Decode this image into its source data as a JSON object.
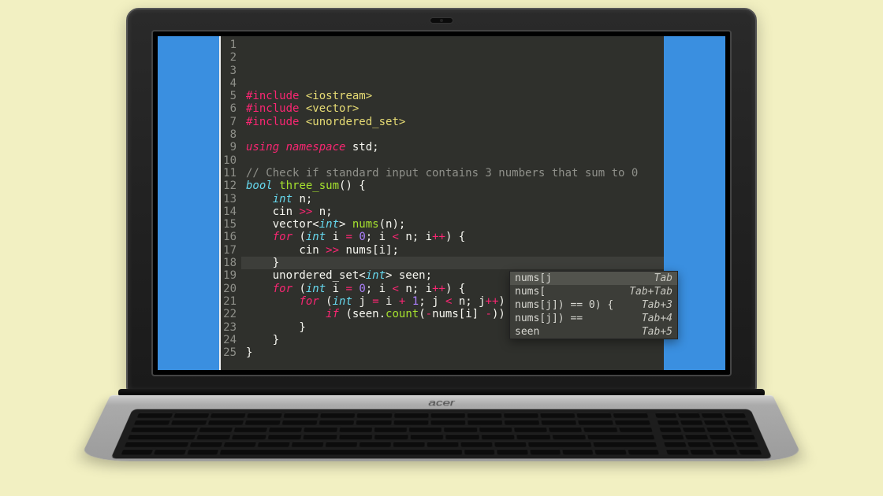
{
  "brand": "acer",
  "editor": {
    "total_lines": 25,
    "highlighted_line": 18,
    "lines": [
      {
        "n": 1,
        "tokens": [
          [
            "kw2",
            "#include"
          ],
          [
            "wh",
            " "
          ],
          [
            "st",
            "<iostream>"
          ]
        ]
      },
      {
        "n": 2,
        "tokens": [
          [
            "kw2",
            "#include"
          ],
          [
            "wh",
            " "
          ],
          [
            "st",
            "<vector>"
          ]
        ]
      },
      {
        "n": 3,
        "tokens": [
          [
            "kw2",
            "#include"
          ],
          [
            "wh",
            " "
          ],
          [
            "st",
            "<unordered_set>"
          ]
        ]
      },
      {
        "n": 4,
        "tokens": []
      },
      {
        "n": 5,
        "tokens": [
          [
            "kw",
            "using"
          ],
          [
            "wh",
            " "
          ],
          [
            "kw",
            "namespace"
          ],
          [
            "wh",
            " std;"
          ]
        ]
      },
      {
        "n": 6,
        "tokens": []
      },
      {
        "n": 7,
        "tokens": [
          [
            "co",
            "// Check if standard input contains 3 numbers that sum to 0"
          ]
        ]
      },
      {
        "n": 8,
        "tokens": [
          [
            "ty",
            "bool"
          ],
          [
            "wh",
            " "
          ],
          [
            "fn",
            "three_sum"
          ],
          [
            "wh",
            "() {"
          ]
        ]
      },
      {
        "n": 9,
        "tokens": [
          [
            "wh",
            "    "
          ],
          [
            "ty",
            "int"
          ],
          [
            "wh",
            " n;"
          ]
        ]
      },
      {
        "n": 10,
        "tokens": [
          [
            "wh",
            "    cin "
          ],
          [
            "op",
            ">>"
          ],
          [
            "wh",
            " n;"
          ]
        ]
      },
      {
        "n": 11,
        "tokens": [
          [
            "wh",
            "    vector<"
          ],
          [
            "ty",
            "int"
          ],
          [
            "wh",
            "> "
          ],
          [
            "fn",
            "nums"
          ],
          [
            "wh",
            "(n);"
          ]
        ]
      },
      {
        "n": 12,
        "tokens": [
          [
            "wh",
            "    "
          ],
          [
            "kw",
            "for"
          ],
          [
            "wh",
            " ("
          ],
          [
            "ty",
            "int"
          ],
          [
            "wh",
            " i "
          ],
          [
            "op",
            "="
          ],
          [
            "wh",
            " "
          ],
          [
            "nu",
            "0"
          ],
          [
            "wh",
            "; i "
          ],
          [
            "op",
            "<"
          ],
          [
            "wh",
            " n; i"
          ],
          [
            "op",
            "++"
          ],
          [
            "wh",
            ") {"
          ]
        ]
      },
      {
        "n": 13,
        "tokens": [
          [
            "wh",
            "        cin "
          ],
          [
            "op",
            ">>"
          ],
          [
            "wh",
            " nums[i];"
          ]
        ]
      },
      {
        "n": 14,
        "tokens": [
          [
            "wh",
            "    }"
          ]
        ]
      },
      {
        "n": 15,
        "tokens": [
          [
            "wh",
            "    unordered_set<"
          ],
          [
            "ty",
            "int"
          ],
          [
            "wh",
            "> seen;"
          ]
        ]
      },
      {
        "n": 16,
        "tokens": [
          [
            "wh",
            "    "
          ],
          [
            "kw",
            "for"
          ],
          [
            "wh",
            " ("
          ],
          [
            "ty",
            "int"
          ],
          [
            "wh",
            " i "
          ],
          [
            "op",
            "="
          ],
          [
            "wh",
            " "
          ],
          [
            "nu",
            "0"
          ],
          [
            "wh",
            "; i "
          ],
          [
            "op",
            "<"
          ],
          [
            "wh",
            " n; i"
          ],
          [
            "op",
            "++"
          ],
          [
            "wh",
            ") {"
          ]
        ]
      },
      {
        "n": 17,
        "tokens": [
          [
            "wh",
            "        "
          ],
          [
            "kw",
            "for"
          ],
          [
            "wh",
            " ("
          ],
          [
            "ty",
            "int"
          ],
          [
            "wh",
            " j "
          ],
          [
            "op",
            "="
          ],
          [
            "wh",
            " i "
          ],
          [
            "op",
            "+"
          ],
          [
            "wh",
            " "
          ],
          [
            "nu",
            "1"
          ],
          [
            "wh",
            "; j "
          ],
          [
            "op",
            "<"
          ],
          [
            "wh",
            " n; j"
          ],
          [
            "op",
            "++"
          ],
          [
            "wh",
            ") {"
          ]
        ]
      },
      {
        "n": 18,
        "tokens": [
          [
            "wh",
            "            "
          ],
          [
            "kw",
            "if"
          ],
          [
            "wh",
            " (seen."
          ],
          [
            "fn",
            "count"
          ],
          [
            "wh",
            "("
          ],
          [
            "op",
            "-"
          ],
          [
            "wh",
            "nums[i] "
          ],
          [
            "op",
            "-"
          ],
          [
            "wh",
            "))"
          ]
        ]
      },
      {
        "n": 19,
        "tokens": [
          [
            "wh",
            "        }"
          ]
        ]
      },
      {
        "n": 20,
        "tokens": [
          [
            "wh",
            "    }"
          ]
        ]
      },
      {
        "n": 21,
        "tokens": [
          [
            "wh",
            "}"
          ]
        ]
      },
      {
        "n": 22,
        "tokens": []
      },
      {
        "n": 23,
        "tokens": []
      },
      {
        "n": 24,
        "tokens": []
      },
      {
        "n": 25,
        "tokens": []
      }
    ]
  },
  "autocomplete": {
    "items": [
      {
        "text": "nums[j",
        "hint": "Tab",
        "selected": true
      },
      {
        "text": "nums[",
        "hint": "Tab+Tab",
        "selected": false
      },
      {
        "text": "nums[j]) == 0) {",
        "hint": "Tab+3",
        "selected": false
      },
      {
        "text": "nums[j]) ==",
        "hint": "Tab+4",
        "selected": false
      },
      {
        "text": "seen",
        "hint": "Tab+5",
        "selected": false
      }
    ]
  }
}
